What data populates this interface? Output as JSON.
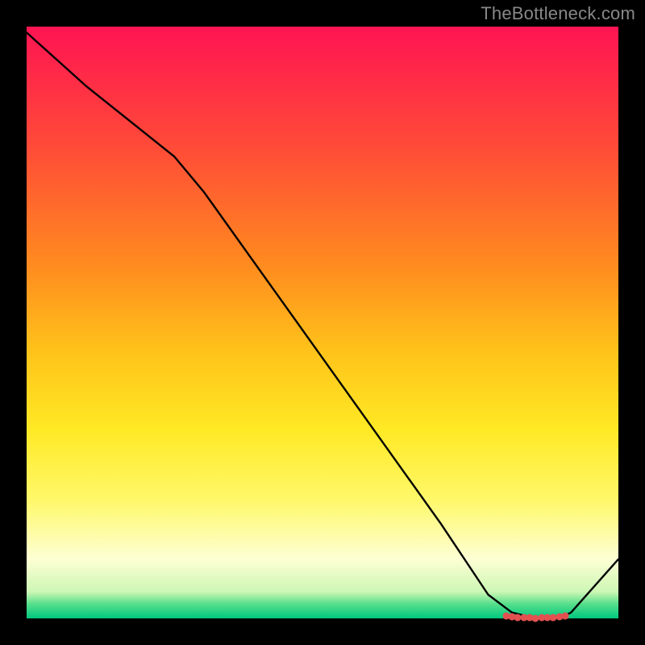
{
  "watermark": "TheBottleneck.com",
  "chart_data": {
    "type": "line",
    "title": "",
    "xlabel": "",
    "ylabel": "",
    "xlim": [
      0,
      100
    ],
    "ylim": [
      0,
      100
    ],
    "x": [
      0,
      10,
      20,
      25,
      30,
      40,
      50,
      60,
      70,
      78,
      82,
      86,
      90,
      92,
      100
    ],
    "values": [
      99,
      90,
      82,
      78,
      72,
      58,
      44,
      30,
      16,
      4,
      1,
      0,
      0,
      1,
      10
    ],
    "markers_x": [
      81,
      82,
      83,
      84,
      85,
      86,
      87,
      88,
      89,
      90,
      91
    ],
    "markers_y": [
      0.4,
      0.3,
      0.2,
      0.1,
      0.1,
      0.0,
      0.1,
      0.1,
      0.2,
      0.3,
      0.4
    ],
    "gradient_stops": [
      {
        "offset": 0.0,
        "color": "#ff1452"
      },
      {
        "offset": 0.2,
        "color": "#ff4a38"
      },
      {
        "offset": 0.4,
        "color": "#ff8a1f"
      },
      {
        "offset": 0.55,
        "color": "#ffc31a"
      },
      {
        "offset": 0.68,
        "color": "#ffe924"
      },
      {
        "offset": 0.8,
        "color": "#fff86a"
      },
      {
        "offset": 0.9,
        "color": "#fdffd4"
      },
      {
        "offset": 0.955,
        "color": "#cdf7b4"
      },
      {
        "offset": 0.975,
        "color": "#59e08c"
      },
      {
        "offset": 1.0,
        "color": "#00c77f"
      }
    ]
  }
}
